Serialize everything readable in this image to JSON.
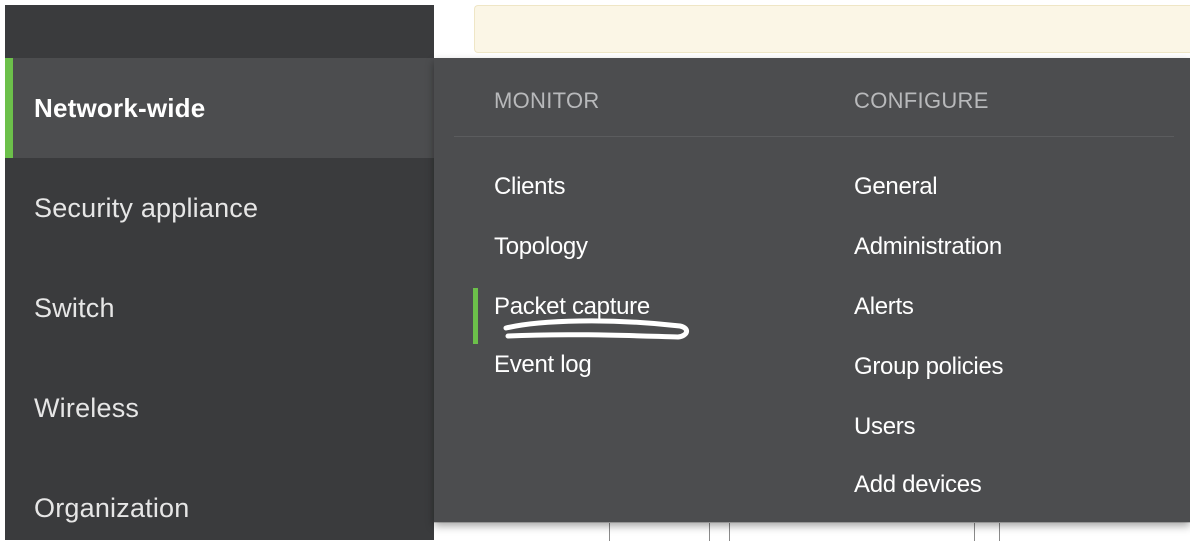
{
  "sidebar": {
    "items": [
      {
        "label": "Network-wide",
        "active": true
      },
      {
        "label": "Security appliance",
        "active": false
      },
      {
        "label": "Switch",
        "active": false
      },
      {
        "label": "Wireless",
        "active": false
      },
      {
        "label": "Organization",
        "active": false
      }
    ]
  },
  "flyout": {
    "monitor": {
      "heading": "MONITOR",
      "items": [
        {
          "label": "Clients",
          "active": false
        },
        {
          "label": "Topology",
          "active": false
        },
        {
          "label": "Packet capture",
          "active": true
        },
        {
          "label": "Event log",
          "active": false
        }
      ]
    },
    "configure": {
      "heading": "CONFIGURE",
      "items": [
        {
          "label": "General"
        },
        {
          "label": "Administration"
        },
        {
          "label": "Alerts"
        },
        {
          "label": "Group policies"
        },
        {
          "label": "Users"
        },
        {
          "label": "Add devices"
        }
      ]
    }
  },
  "colors": {
    "sidebar_bg": "#3a3b3d",
    "active_bg": "#4c4d4f",
    "accent_green": "#6cc04a",
    "heading_gray": "#b8b9bb",
    "banner_bg": "#fbf6e6",
    "scribble": "#ffffff"
  }
}
